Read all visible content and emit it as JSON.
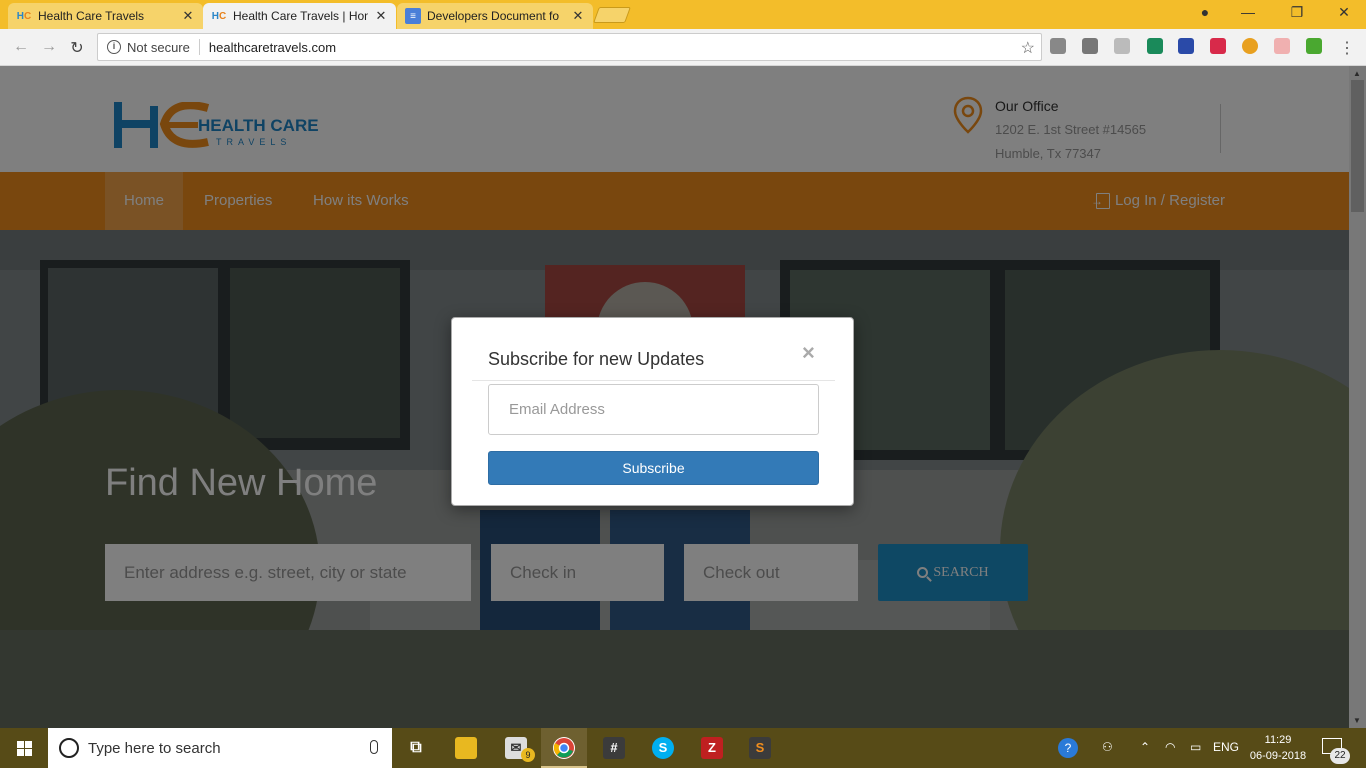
{
  "browser": {
    "tabs": [
      {
        "title": "Health Care Travels",
        "favicon": "hc-logo-icon",
        "active": false
      },
      {
        "title": "Health Care Travels | Hom",
        "favicon": "hc-logo-icon",
        "active": true
      },
      {
        "title": "Developers Document fo",
        "favicon": "google-docs-icon",
        "active": false
      }
    ],
    "security_label": "Not secure",
    "url": "healthcaretravels.com"
  },
  "site": {
    "logo_text": "HEALTH CARE",
    "logo_sub": "TRAVELS",
    "office": {
      "title": "Our Office",
      "address_line1": "1202 E. 1st Street #14565",
      "address_line2": "Humble, Tx 77347"
    },
    "nav": [
      {
        "label": "Home",
        "active": true
      },
      {
        "label": "Properties",
        "active": false
      },
      {
        "label": "How its Works",
        "active": false
      }
    ],
    "login_label": "Log In / Register",
    "hero": {
      "title": "Find New Home",
      "address_placeholder": "Enter address e.g. street, city or state",
      "checkin_placeholder": "Check in",
      "checkout_placeholder": "Check out",
      "search_label": "SEARCH"
    },
    "colors": {
      "primary": "#f28e1c",
      "search_button": "#1c91c8",
      "subscribe_button": "#337ab7"
    }
  },
  "modal": {
    "title": "Subscribe for new Updates",
    "close_symbol": "×",
    "email_placeholder": "Email Address",
    "button_label": "Subscribe"
  },
  "taskbar": {
    "search_placeholder": "Type here to search",
    "mail_badge": "9",
    "language": "ENG",
    "time": "11:29",
    "date": "06-09-2018",
    "notifications": "22"
  }
}
